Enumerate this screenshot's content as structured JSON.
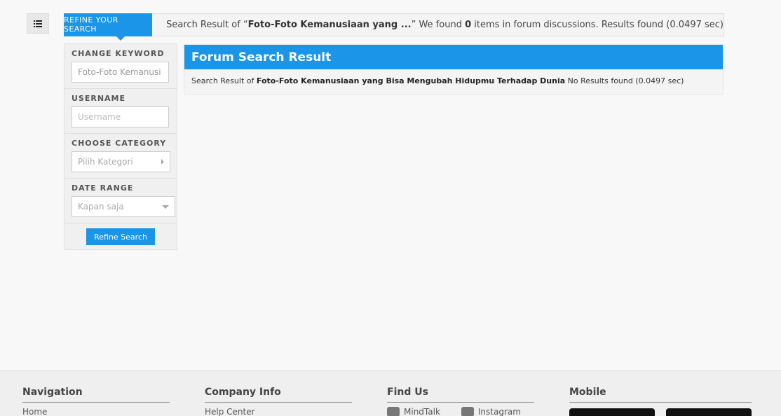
{
  "refine_tab": {
    "label": "REFINE YOUR SEARCH"
  },
  "summary": {
    "prefix": "Search Result of “",
    "keyword": "Foto-Foto Kemanusiaan yang ...",
    "middle": "” We found ",
    "count": "0",
    "suffix": " items in forum discussions. Results found (0.0497 sec)"
  },
  "sidebar": {
    "keyword_label": "CHANGE KEYWORD",
    "keyword_value": "Foto-Foto Kemanusi",
    "username_label": "USERNAME",
    "username_placeholder": "Username",
    "category_label": "CHOOSE CATEGORY",
    "category_value": "Pilih Kategori",
    "date_label": "DATE RANGE",
    "date_value": "Kapan saja",
    "button_label": "Refine Search"
  },
  "result": {
    "title": "Forum Search Result",
    "prefix": "Search Result of ",
    "query": "Foto-Foto Kemanusiaan yang Bisa Mengubah Hidupmu Terhadap Dunia",
    "suffix": " No Results found (0.0497 sec)"
  },
  "footer": {
    "navigation": {
      "title": "Navigation",
      "links": [
        "Home"
      ]
    },
    "company": {
      "title": "Company Info",
      "links": [
        "Help Center"
      ]
    },
    "find_us": {
      "title": "Find Us",
      "links": [
        "MindTalk",
        "Instagram"
      ]
    },
    "mobile": {
      "title": "Mobile"
    }
  },
  "colors": {
    "accent": "#1b95e7",
    "background": "#f8f8f8"
  }
}
